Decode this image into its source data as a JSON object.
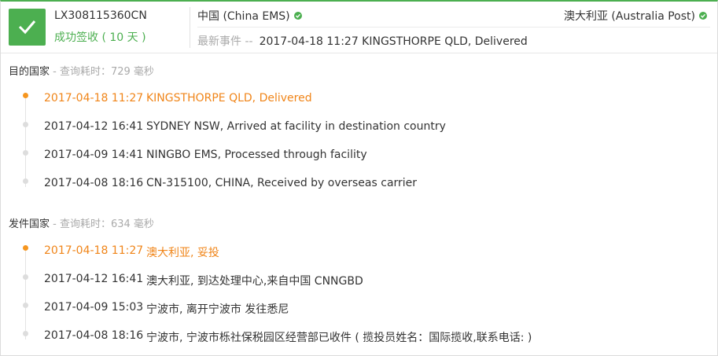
{
  "header": {
    "tracking_number": "LX308115360CN",
    "status_text": "成功签收 ( 10 天 )",
    "origin_carrier": "中国 (China EMS)",
    "destination_carrier": "澳大利亚 (Australia Post)",
    "latest_event_label": "最新事件 --",
    "latest_event_value": "2017-04-18 11:27 KINGSTHORPE QLD, Delivered",
    "icons": {
      "status": "check-icon",
      "carrier_ok": "check-circle-icon"
    }
  },
  "destination": {
    "title": "目的国家",
    "meta": " - 查询耗时：729 毫秒",
    "events": [
      {
        "time": "2017-04-18 11:27",
        "desc": "KINGSTHORPE QLD, Delivered"
      },
      {
        "time": "2017-04-12 16:41",
        "desc": "SYDNEY NSW, Arrived at facility in destination country"
      },
      {
        "time": "2017-04-09 14:41",
        "desc": "NINGBO EMS, Processed through facility"
      },
      {
        "time": "2017-04-08 18:16",
        "desc": "CN-315100, CHINA, Received by overseas carrier"
      }
    ]
  },
  "origin": {
    "title": "发件国家",
    "meta": " - 查询耗时：634 毫秒",
    "events": [
      {
        "time": "2017-04-18 11:27",
        "desc": "澳大利亚, 妥投"
      },
      {
        "time": "2017-04-12 16:41",
        "desc": "澳大利亚, 到达处理中心,来自中国 CNNGBD"
      },
      {
        "time": "2017-04-09 15:03",
        "desc": "宁波市, 离开宁波市 发往悉尼"
      },
      {
        "time": "2017-04-08 18:16",
        "desc": "宁波市, 宁波市栎社保税园区经营部已收件 ( 揽投员姓名：国际揽收,联系电话: )"
      }
    ]
  },
  "colors": {
    "success": "#4caf50",
    "active": "#f08519",
    "muted": "#aaaaaa"
  }
}
